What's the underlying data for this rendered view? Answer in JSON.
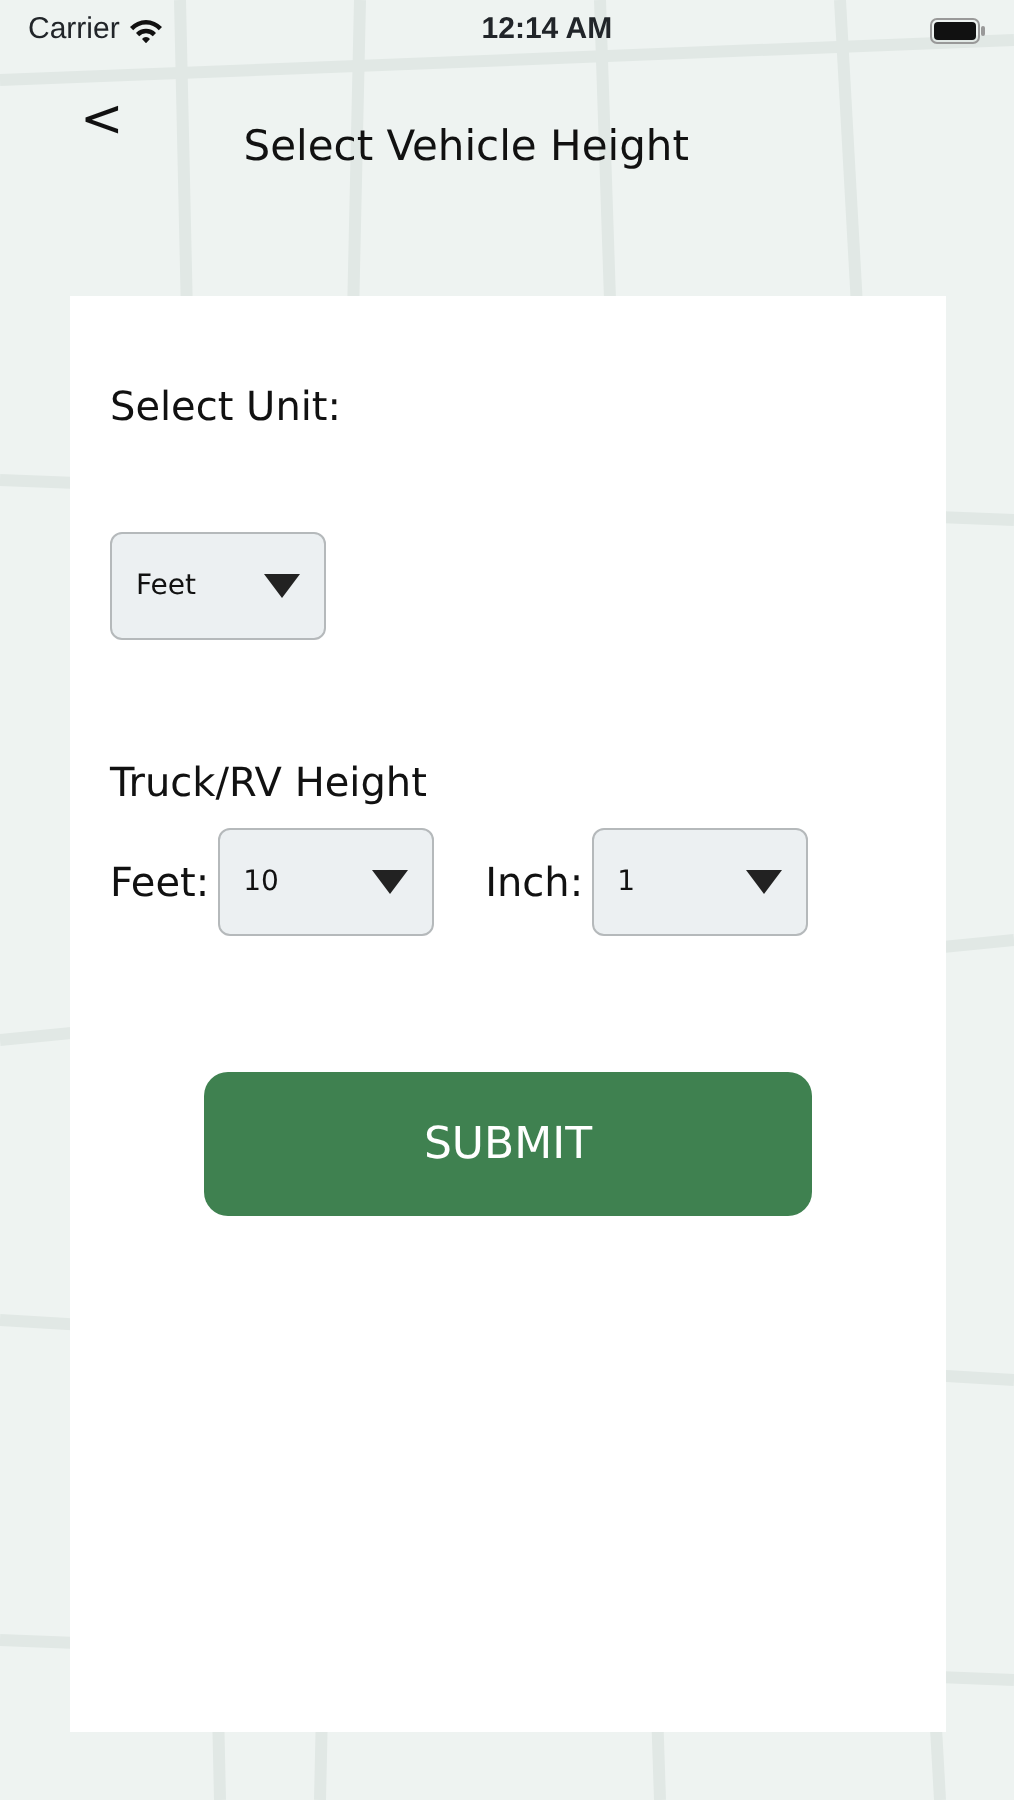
{
  "status_bar": {
    "carrier": "Carrier",
    "time": "12:14 AM"
  },
  "header": {
    "back": "<",
    "title": "Select Vehicle Height"
  },
  "form": {
    "unit_label": "Select Unit:",
    "unit_value": "Feet",
    "height_label": "Truck/RV Height",
    "fields": [
      {
        "label": "Feet:",
        "value": "10"
      },
      {
        "label": "Inch:",
        "value": "1"
      }
    ],
    "submit": "SUBMIT"
  }
}
